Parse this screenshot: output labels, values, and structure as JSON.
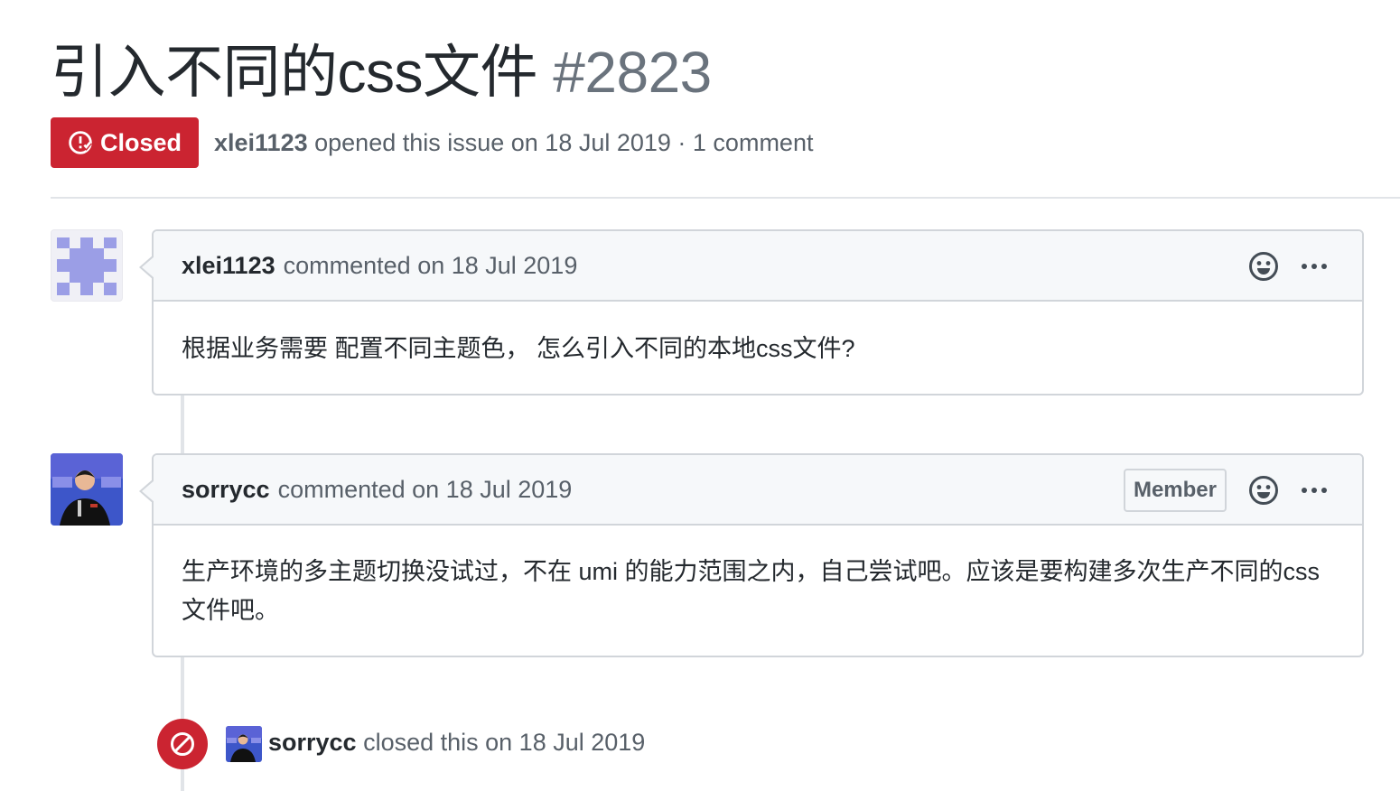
{
  "issue": {
    "title": "引入不同的css文件",
    "number": "#2823",
    "state": "Closed",
    "author": "xlei1123",
    "meta_text": " opened this issue on 18 Jul 2019 · 1 comment"
  },
  "comments": [
    {
      "author": "xlei1123",
      "meta": "commented on 18 Jul 2019",
      "body": "根据业务需要 配置不同主题色， 怎么引入不同的本地css文件?"
    },
    {
      "author": "sorrycc",
      "meta": "commented on 18 Jul 2019",
      "role": "Member",
      "body": "生产环境的多主题切换没试过，不在 umi 的能力范围之内，自己尝试吧。应该是要构建多次生产不同的css 文件吧。"
    }
  ],
  "events": [
    {
      "actor": "sorrycc",
      "text": " closed this on 18 Jul 2019"
    }
  ],
  "icons": {
    "state": "issue-closed-icon",
    "reaction": "smiley-icon",
    "more": "kebab-horizontal-icon",
    "event": "circle-slash-icon"
  },
  "colors": {
    "closed_red": "#cb2431",
    "identicon": "#9b9ee6"
  }
}
